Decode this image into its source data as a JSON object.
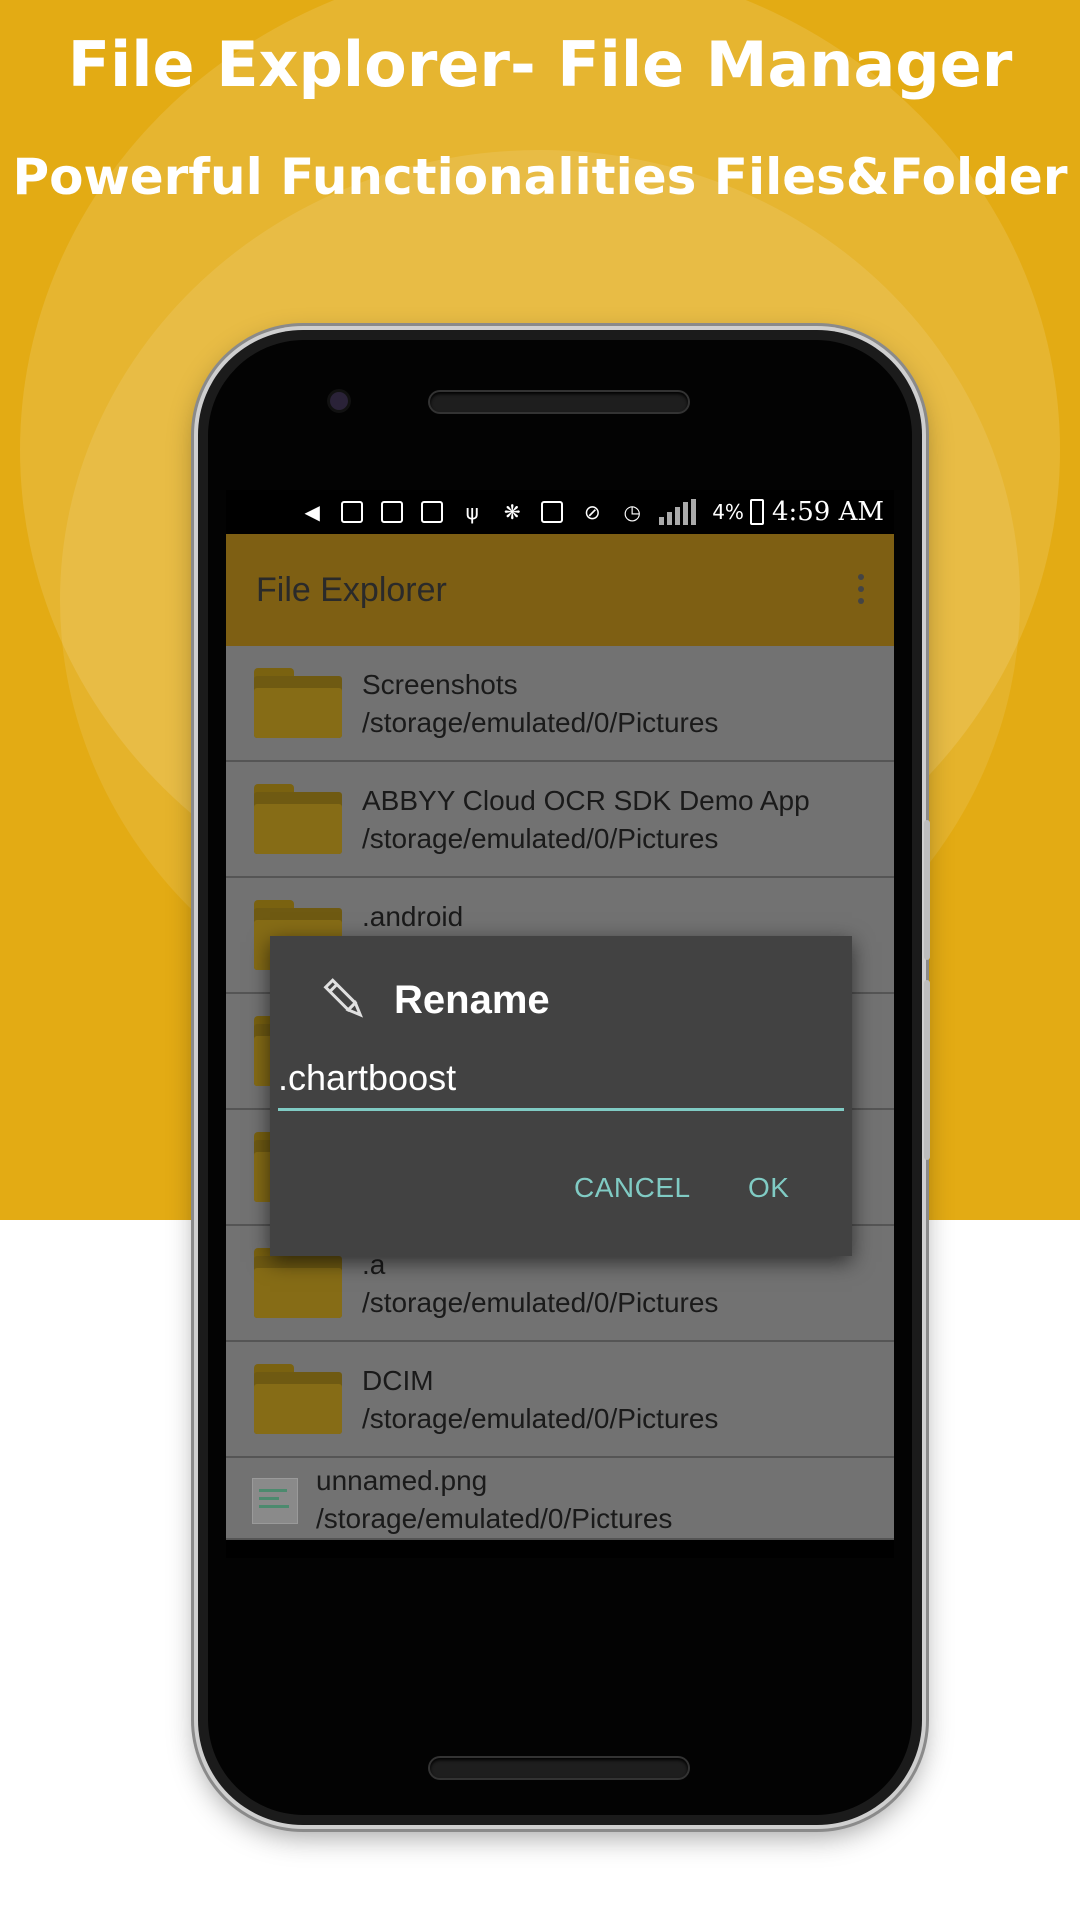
{
  "promo": {
    "headline": "File Explorer- File Manager",
    "subheadline": "Powerful Functionalities Files&Folder",
    "colors": {
      "background": "#e3ab14",
      "text": "#ffffff"
    }
  },
  "status_bar": {
    "battery": "4%",
    "time": "4:59 AM",
    "icons": [
      "more-icon",
      "mosque-icon",
      "mosque-icon",
      "image-icon",
      "usb-icon",
      "squirrel-icon",
      "nfc-icon",
      "mute-icon",
      "alarm-icon",
      "signal-icon"
    ]
  },
  "app_bar": {
    "title": "File Explorer",
    "color": "#7e5f13"
  },
  "list": [
    {
      "name": "Screenshots",
      "path": "/storage/emulated/0/Pictures",
      "type": "folder"
    },
    {
      "name": "ABBYY Cloud OCR SDK Demo App",
      "path": "/storage/emulated/0/Pictures",
      "type": "folder"
    },
    {
      "name": ".android",
      "path": "",
      "type": "folder"
    },
    {
      "name": "",
      "path": "",
      "type": "folder"
    },
    {
      "name": "",
      "path": "",
      "type": "folder"
    },
    {
      "name": ".a",
      "path": "/storage/emulated/0/Pictures",
      "type": "folder"
    },
    {
      "name": "DCIM",
      "path": "/storage/emulated/0/Pictures",
      "type": "folder"
    },
    {
      "name": "unnamed.png",
      "path": "/storage/emulated/0/Pictures",
      "type": "file"
    }
  ],
  "dialog": {
    "title": "Rename",
    "input_value": ".chartboost",
    "cancel_label": "CANCEL",
    "ok_label": "OK",
    "accent": "#80cbc4"
  }
}
